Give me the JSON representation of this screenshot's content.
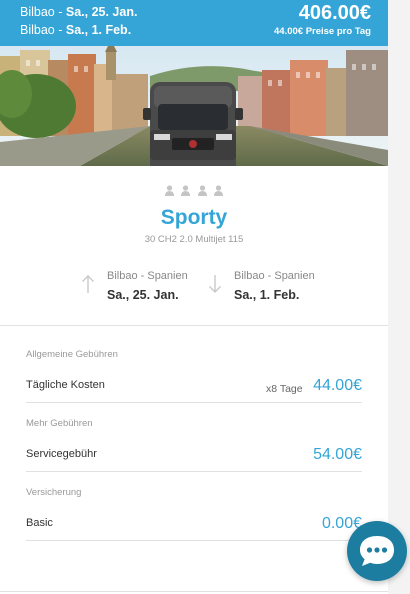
{
  "header": {
    "pickup": {
      "city": "Bilbao - ",
      "date": "Sa., 25. Jan."
    },
    "return": {
      "city": "Bilbao - ",
      "date": "Sa., 1. Feb."
    },
    "total_price": "406.00€",
    "price_per_day": "44.00€ Preise pro Tag"
  },
  "vehicle": {
    "name": "Sporty",
    "model": "30 CH2 2.0 Multijet 115",
    "capacity_icons": [
      "person-icon",
      "person-icon",
      "person-icon",
      "person-icon"
    ]
  },
  "trip": {
    "pickup": {
      "location": "Bilbao - Spanien",
      "date": "Sa., 25. Jan."
    },
    "return": {
      "location": "Bilbao - Spanien",
      "date": "Sa., 1. Feb."
    }
  },
  "fees": {
    "general": {
      "title": "Allgemeine Gebühren",
      "daily": {
        "label": "Tägliche Kosten",
        "days": "x8 Tage",
        "amount": "44.00€"
      }
    },
    "more": {
      "title": "Mehr Gebühren",
      "service": {
        "label": "Servicegebühr",
        "amount": "54.00€"
      }
    },
    "insurance": {
      "title": "Versicherung",
      "basic": {
        "label": "Basic",
        "amount": "0.00€"
      }
    }
  },
  "chat": {
    "icon": "chat-bubble-icon"
  },
  "colors": {
    "accent": "#34a5d6",
    "chat": "#1c7da0"
  }
}
